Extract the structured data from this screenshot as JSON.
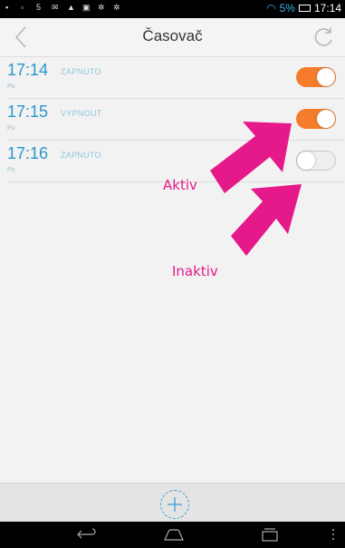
{
  "status_bar": {
    "signal_text": "5",
    "battery_text": "5%",
    "clock": "17:14"
  },
  "header": {
    "title": "Časovač",
    "back_icon": "chevron-left-icon",
    "refresh_icon": "refresh-icon"
  },
  "timers": [
    {
      "time": "17:14",
      "state": "ZAPNUTO",
      "day": "Po",
      "enabled": true
    },
    {
      "time": "17:15",
      "state": "VYPNOUT",
      "day": "Po",
      "enabled": true
    },
    {
      "time": "17:16",
      "state": "ZAPNUTO",
      "day": "Po",
      "enabled": false
    }
  ],
  "annotations": {
    "active_label": "Aktiv",
    "inactive_label": "Inaktiv",
    "color": "#e5198a"
  },
  "bottom": {
    "add_icon": "plus-icon"
  },
  "colors": {
    "accent_blue": "#2a98cc",
    "toggle_on": "#f57c2a"
  }
}
